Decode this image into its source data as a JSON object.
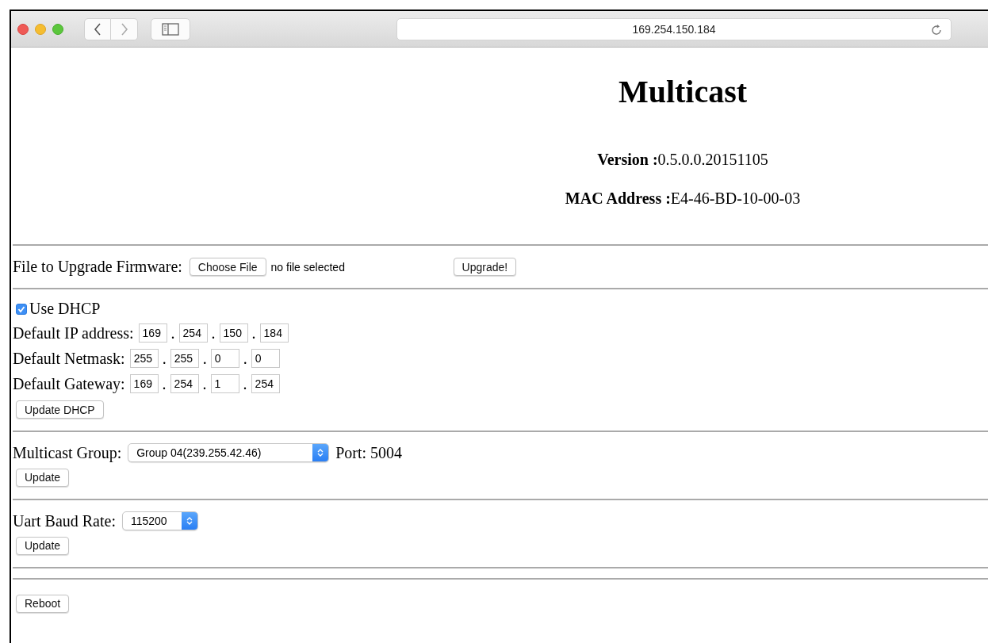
{
  "browser": {
    "address": "169.254.150.184"
  },
  "header": {
    "title": "Multicast",
    "version": {
      "label": "Version :",
      "value": "0.5.0.0.20151105"
    },
    "mac": {
      "label": "MAC Address :",
      "value": "E4-46-BD-10-00-03"
    }
  },
  "firmware": {
    "label": "File to Upgrade Firmware:",
    "choose_button": "Choose File",
    "file_status": "no file selected",
    "upgrade_button": "Upgrade!"
  },
  "network": {
    "dhcp": {
      "label": "Use DHCP",
      "checked": true
    },
    "rows": [
      {
        "label": "Default IP address:",
        "parts": [
          {
            "kind": "octet",
            "text": "169"
          },
          {
            "kind": "dot",
            "text": "."
          },
          {
            "kind": "octet",
            "text": "254"
          },
          {
            "kind": "dot",
            "text": "."
          },
          {
            "kind": "octet",
            "text": "150"
          },
          {
            "kind": "dot",
            "text": "."
          },
          {
            "kind": "octet",
            "text": "184"
          }
        ]
      },
      {
        "label": "Default Netmask:",
        "parts": [
          {
            "kind": "octet",
            "text": "255"
          },
          {
            "kind": "dot",
            "text": "."
          },
          {
            "kind": "octet",
            "text": "255"
          },
          {
            "kind": "dot",
            "text": "."
          },
          {
            "kind": "octet",
            "text": "0"
          },
          {
            "kind": "dot",
            "text": "."
          },
          {
            "kind": "octet",
            "text": "0"
          }
        ]
      },
      {
        "label": "Default Gateway:",
        "parts": [
          {
            "kind": "octet",
            "text": "169"
          },
          {
            "kind": "dot",
            "text": "."
          },
          {
            "kind": "octet",
            "text": "254"
          },
          {
            "kind": "dot",
            "text": "."
          },
          {
            "kind": "octet",
            "text": "1"
          },
          {
            "kind": "dot",
            "text": "."
          },
          {
            "kind": "octet",
            "text": "254"
          }
        ]
      }
    ],
    "button": "Update DHCP"
  },
  "multicast": {
    "label": "Multicast Group:",
    "selected_option": "Group 04(239.255.42.46)",
    "port": "Port: 5004",
    "button": "Update"
  },
  "uart": {
    "label": "Uart Baud Rate:",
    "selected_option": "115200",
    "button": "Update"
  },
  "reboot": {
    "button": "Reboot"
  }
}
